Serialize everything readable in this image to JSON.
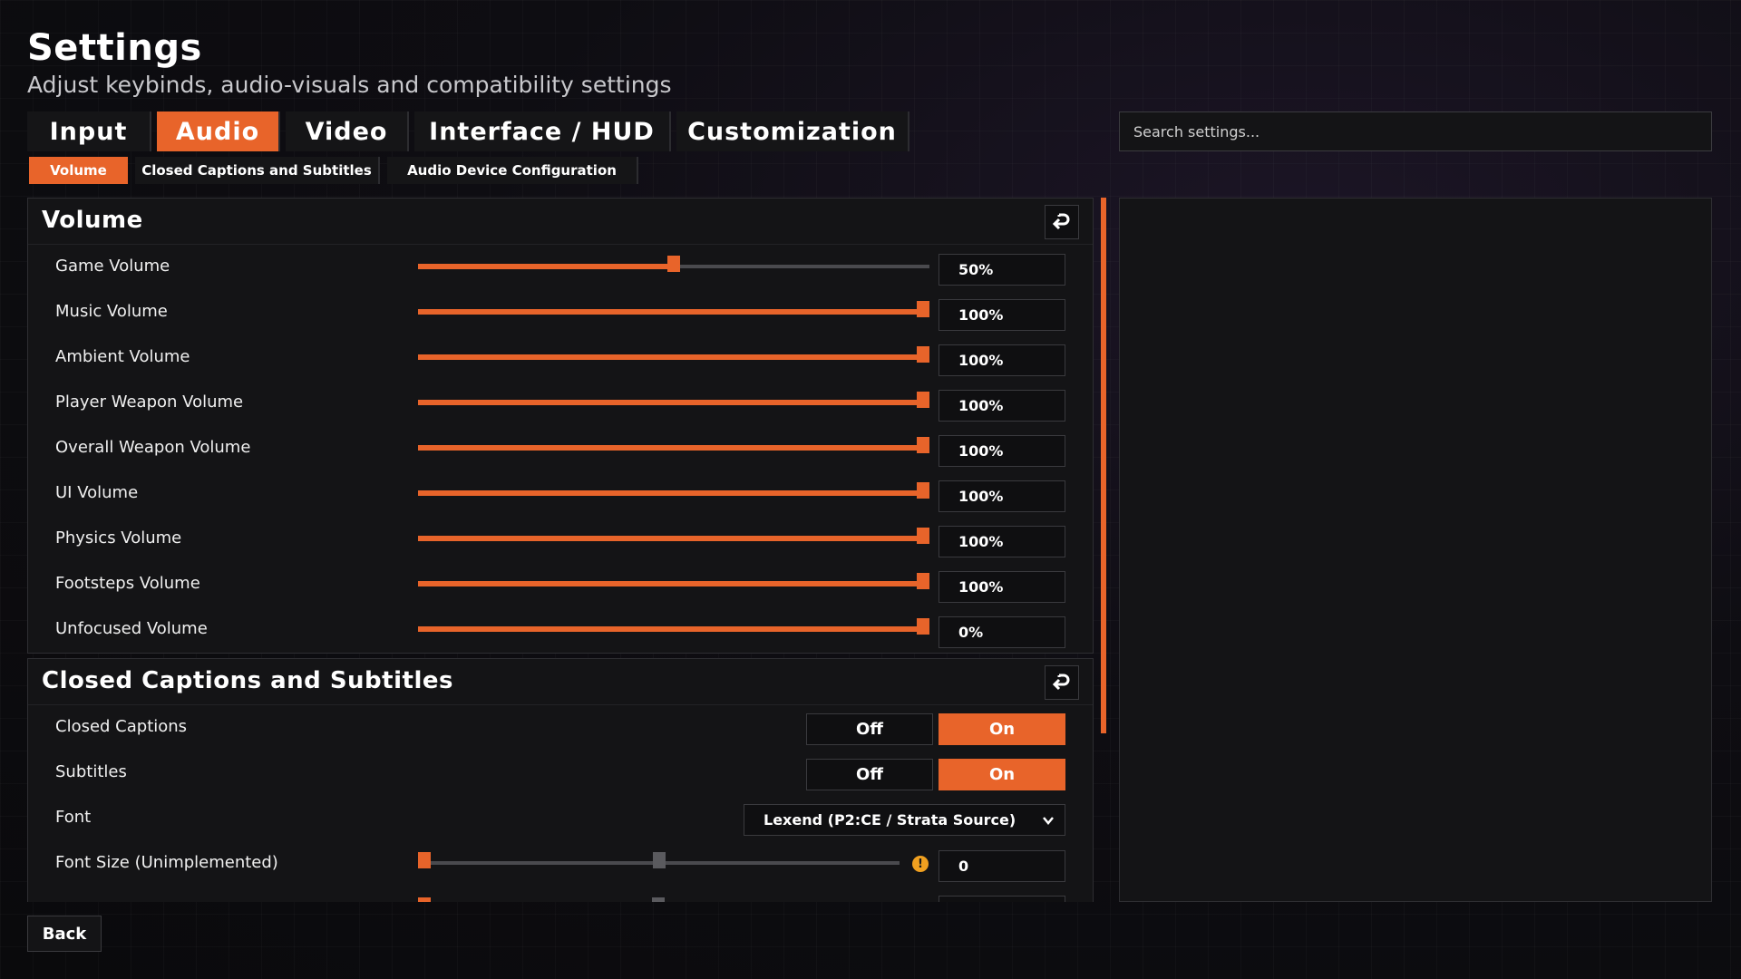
{
  "header": {
    "title": "Settings",
    "subtitle": "Adjust keybinds, audio-visuals and compatibility settings"
  },
  "tabs": [
    {
      "label": "Input",
      "active": false
    },
    {
      "label": "Audio",
      "active": true
    },
    {
      "label": "Video",
      "active": false
    },
    {
      "label": "Interface / HUD",
      "active": false
    },
    {
      "label": "Customization",
      "active": false
    }
  ],
  "subtabs": [
    {
      "label": "Volume",
      "active": true
    },
    {
      "label": "Closed Captions and Subtitles",
      "active": false
    },
    {
      "label": "Audio Device Configuration",
      "active": false
    }
  ],
  "search": {
    "placeholder": "Search settings..."
  },
  "volume_section": {
    "title": "Volume",
    "rows": [
      {
        "label": "Game Volume",
        "value": "50%",
        "level": 0.5
      },
      {
        "label": "Music Volume",
        "value": "100%",
        "level": 1.0
      },
      {
        "label": "Ambient Volume",
        "value": "100%",
        "level": 1.0
      },
      {
        "label": "Player Weapon Volume",
        "value": "100%",
        "level": 1.0
      },
      {
        "label": "Overall Weapon Volume",
        "value": "100%",
        "level": 1.0
      },
      {
        "label": "UI Volume",
        "value": "100%",
        "level": 1.0
      },
      {
        "label": "Physics Volume",
        "value": "100%",
        "level": 1.0
      },
      {
        "label": "Footsteps Volume",
        "value": "100%",
        "level": 1.0
      },
      {
        "label": "Unfocused Volume",
        "value": "0%",
        "level": 1.0
      }
    ]
  },
  "captions_section": {
    "title": "Closed Captions and Subtitles",
    "closed_captions": {
      "label": "Closed Captions",
      "off": "Off",
      "on": "On",
      "selected": "On"
    },
    "subtitles": {
      "label": "Subtitles",
      "off": "Off",
      "on": "On",
      "selected": "On"
    },
    "font": {
      "label": "Font",
      "value": "Lexend (P2:CE / Strata Source)"
    },
    "font_size": {
      "label": "Font Size (Unimplemented)",
      "value": "0",
      "level": 0.0,
      "default_level": 0.5,
      "warning": "!"
    }
  },
  "footer": {
    "back_label": "Back"
  },
  "colors": {
    "accent": "#e8642a",
    "panel": "#141416",
    "warning": "#f0a020"
  }
}
